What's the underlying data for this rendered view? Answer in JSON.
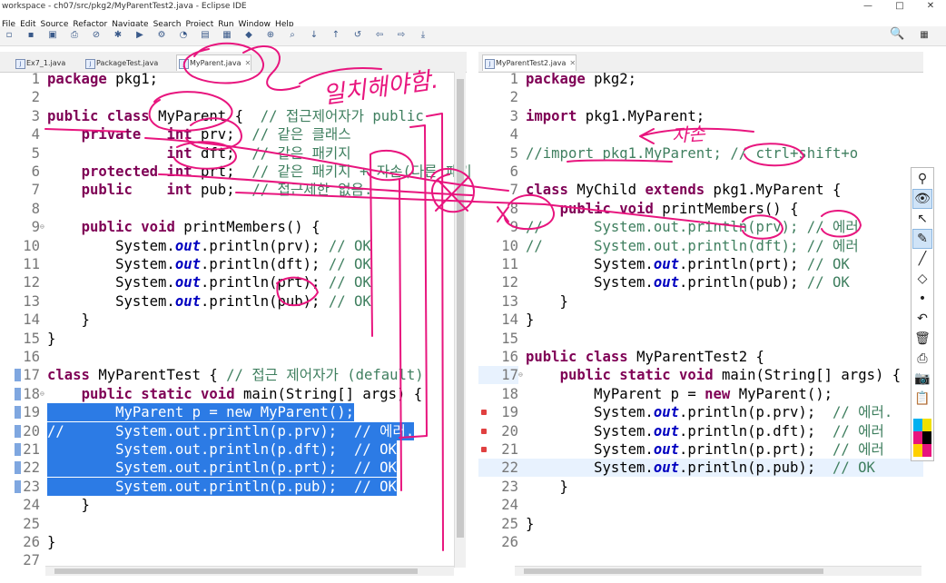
{
  "window": {
    "title": "workspace - ch07/src/pkg2/MyParentTest2.java - Eclipse IDE",
    "controls": [
      "—",
      "□",
      "✕"
    ]
  },
  "menu": [
    "File",
    "Edit",
    "Source",
    "Refactor",
    "Navigate",
    "Search",
    "Project",
    "Run",
    "Window",
    "Help"
  ],
  "toolbar": {
    "icons": [
      "new-icon",
      "save-icon",
      "save-all-icon",
      "print-icon",
      "skip-breakpoints-icon",
      "debug-icon",
      "run-icon",
      "external-tools-icon",
      "coverage-icon",
      "new-java-project-icon",
      "new-package-icon",
      "new-class-icon",
      "open-type-icon",
      "search-icon",
      "next-annotation-icon",
      "prev-annotation-icon",
      "last-edit-icon",
      "back-icon",
      "forward-icon",
      "pin-editor-icon"
    ],
    "search_icon": "🔍",
    "perspective_icon": "▦"
  },
  "left_editor": {
    "tabs": [
      {
        "label": "Ex7_1.java"
      },
      {
        "label": "PackageTest.java"
      },
      {
        "label": "MyParent.java",
        "close": "✕"
      }
    ],
    "lines": [
      {
        "n": "1",
        "t": "package pkg1;"
      },
      {
        "n": "2",
        "t": ""
      },
      {
        "n": "3",
        "t": "public class MyParent {  // 접근제어자가 public"
      },
      {
        "n": "4",
        "t": "    private   int prv;  // 같은 클래스"
      },
      {
        "n": "5",
        "t": "              int dft;  // 같은 패키지"
      },
      {
        "n": "6",
        "t": "    protected int prt;  // 같은 패키지 + 자손(다른 패키"
      },
      {
        "n": "7",
        "t": "    public    int pub;  // 접근제한 없음."
      },
      {
        "n": "8",
        "t": ""
      },
      {
        "n": "9",
        "t": "    public void printMembers() {"
      },
      {
        "n": "10",
        "t": "        System.out.println(prv); // OK"
      },
      {
        "n": "11",
        "t": "        System.out.println(dft); // OK"
      },
      {
        "n": "12",
        "t": "        System.out.println(prt); // OK"
      },
      {
        "n": "13",
        "t": "        System.out.println(pub); // OK"
      },
      {
        "n": "14",
        "t": "    }"
      },
      {
        "n": "15",
        "t": "}"
      },
      {
        "n": "16",
        "t": ""
      },
      {
        "n": "17",
        "t": "class MyParentTest { // 접근 제어자가 (default)"
      },
      {
        "n": "18",
        "t": "    public static void main(String[] args) {"
      },
      {
        "n": "19",
        "t": "        MyParent p = new MyParent();"
      },
      {
        "n": "20",
        "t": "//      System.out.println(p.prv);  // 에러."
      },
      {
        "n": "21",
        "t": "        System.out.println(p.dft);  // OK"
      },
      {
        "n": "22",
        "t": "        System.out.println(p.prt);  // OK"
      },
      {
        "n": "23",
        "t": "        System.out.println(p.pub);  // OK"
      },
      {
        "n": "24",
        "t": "    }"
      },
      {
        "n": "25",
        "t": ""
      },
      {
        "n": "26",
        "t": "}"
      },
      {
        "n": "27",
        "t": ""
      }
    ]
  },
  "right_editor": {
    "tabs": [
      {
        "label": "MyParentTest2.java",
        "close": "✕"
      }
    ],
    "lines": [
      {
        "n": "1",
        "t": "package pkg2;"
      },
      {
        "n": "2",
        "t": ""
      },
      {
        "n": "3",
        "t": "import pkg1.MyParent;"
      },
      {
        "n": "4",
        "t": ""
      },
      {
        "n": "5",
        "t": "//import pkg1.MyParent; // ctrl+shift+o"
      },
      {
        "n": "6",
        "t": ""
      },
      {
        "n": "7",
        "t": "class MyChild extends pkg1.MyParent {"
      },
      {
        "n": "8",
        "t": "    public void printMembers() {"
      },
      {
        "n": "9",
        "t": "//      System.out.println(prv); // 에러"
      },
      {
        "n": "10",
        "t": "//      System.out.println(dft); // 에러"
      },
      {
        "n": "11",
        "t": "        System.out.println(prt); // OK"
      },
      {
        "n": "12",
        "t": "        System.out.println(pub); // OK"
      },
      {
        "n": "13",
        "t": "    }"
      },
      {
        "n": "14",
        "t": "}"
      },
      {
        "n": "15",
        "t": ""
      },
      {
        "n": "16",
        "t": "public class MyParentTest2 {"
      },
      {
        "n": "17",
        "t": "    public static void main(String[] args) {"
      },
      {
        "n": "18",
        "t": "        MyParent p = new MyParent();"
      },
      {
        "n": "19",
        "t": "        System.out.println(p.prv);  // 에러."
      },
      {
        "n": "20",
        "t": "        System.out.println(p.dft);  // 에러"
      },
      {
        "n": "21",
        "t": "        System.out.println(p.prt);  // 에러"
      },
      {
        "n": "22",
        "t": "        System.out.println(p.pub);  // OK"
      },
      {
        "n": "23",
        "t": "    }"
      },
      {
        "n": "24",
        "t": ""
      },
      {
        "n": "25",
        "t": "}"
      },
      {
        "n": "26",
        "t": ""
      }
    ]
  },
  "palette": {
    "tools": [
      "⚲",
      "👁",
      "↖",
      "✎",
      "╱",
      "◇",
      "•",
      "↶",
      "🗑",
      "⎙",
      "📷",
      "📋"
    ],
    "colors": [
      "#00b0f0",
      "#f0e000",
      "#e8157e",
      "#000000",
      "#ffd000",
      "#e8157e"
    ]
  },
  "annotations": {
    "note_top": "일치해야함.",
    "note_jasok": "자손",
    "ink_color": "#e8157e"
  }
}
